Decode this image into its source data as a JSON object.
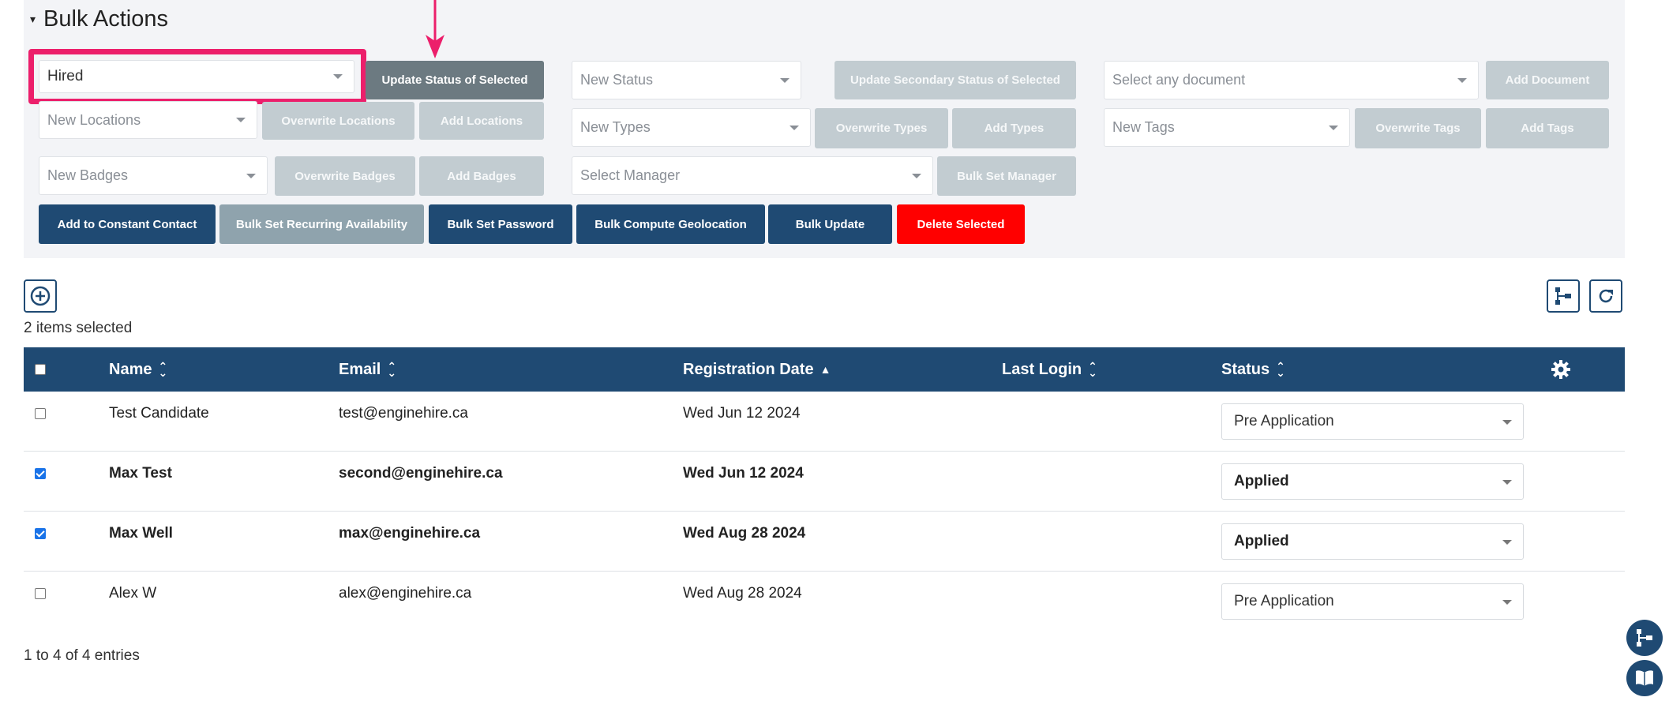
{
  "bulk": {
    "title": "Bulk Actions",
    "status_value": "Hired",
    "update_status_label": "Update Status of Selected",
    "new_status_placeholder": "New Status",
    "update_secondary_label": "Update Secondary Status of Selected",
    "document_placeholder": "Select any document",
    "add_document_label": "Add Document",
    "locations_placeholder": "New Locations",
    "overwrite_locations_label": "Overwrite Locations",
    "add_locations_label": "Add Locations",
    "types_placeholder": "New Types",
    "overwrite_types_label": "Overwrite Types",
    "add_types_label": "Add Types",
    "tags_placeholder": "New Tags",
    "overwrite_tags_label": "Overwrite Tags",
    "add_tags_label": "Add Tags",
    "badges_placeholder": "New Badges",
    "overwrite_badges_label": "Overwrite Badges",
    "add_badges_label": "Add Badges",
    "manager_placeholder": "Select Manager",
    "bulk_set_manager_label": "Bulk Set Manager",
    "constant_contact_label": "Add to Constant Contact",
    "recurring_label": "Bulk Set Recurring Availability",
    "password_label": "Bulk Set Password",
    "geolocation_label": "Bulk Compute Geolocation",
    "bulk_update_label": "Bulk Update",
    "delete_label": "Delete Selected"
  },
  "selection": {
    "count_text": "2 items selected"
  },
  "table": {
    "columns": {
      "name": "Name",
      "email": "Email",
      "registration": "Registration Date",
      "last_login": "Last Login",
      "status": "Status"
    },
    "rows": [
      {
        "checked": false,
        "name": "Test Candidate",
        "email": "test@enginehire.ca",
        "date": "Wed Jun 12 2024",
        "last_login": "",
        "status": "Pre Application"
      },
      {
        "checked": true,
        "name": "Max Test",
        "email": "second@enginehire.ca",
        "date": "Wed Jun 12 2024",
        "last_login": "",
        "status": "Applied"
      },
      {
        "checked": true,
        "name": "Max Well",
        "email": "max@enginehire.ca",
        "date": "Wed Aug 28 2024",
        "last_login": "",
        "status": "Applied"
      },
      {
        "checked": false,
        "name": "Alex W",
        "email": "alex@enginehire.ca",
        "date": "Wed Aug 28 2024",
        "last_login": "",
        "status": "Pre Application"
      }
    ]
  },
  "footer": {
    "entries_text": "1 to 4 of 4 entries"
  },
  "colors": {
    "navy": "#1f4a73",
    "highlight": "#ec1f6b",
    "danger": "#ff0000"
  },
  "icons": [
    "caret-down-icon",
    "plus-circle-icon",
    "hierarchy-icon",
    "refresh-icon",
    "gear-icon",
    "book-icon",
    "sort-icon",
    "sort-up-icon",
    "pointer-arrow-icon"
  ]
}
